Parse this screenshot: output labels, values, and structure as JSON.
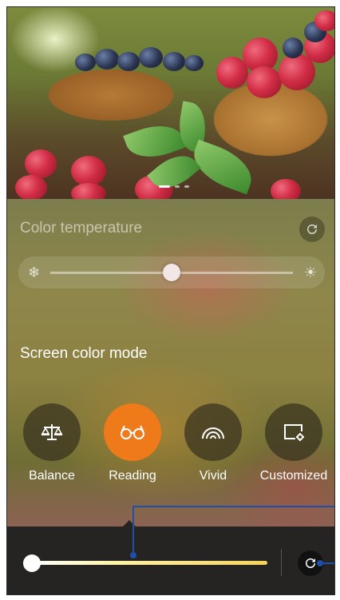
{
  "color_temperature": {
    "title": "Color temperature",
    "value": 0.5,
    "cool_icon": "snowflake-icon",
    "warm_icon": "sun-icon",
    "reset_icon": "refresh-icon"
  },
  "screen_color_mode": {
    "title": "Screen color mode",
    "modes": [
      {
        "label": "Balance",
        "icon": "scale-icon",
        "active": false
      },
      {
        "label": "Reading",
        "icon": "glasses-icon",
        "active": true
      },
      {
        "label": "Vivid",
        "icon": "rainbow-icon",
        "active": false
      },
      {
        "label": "Customized",
        "icon": "custom-display-icon",
        "active": false
      }
    ]
  },
  "bottom_bar": {
    "reading_level": 0.0,
    "reset_icon": "refresh-icon"
  },
  "colors": {
    "accent": "#ee7a1a",
    "callout": "#1f4fa8",
    "bar": "#262423"
  }
}
